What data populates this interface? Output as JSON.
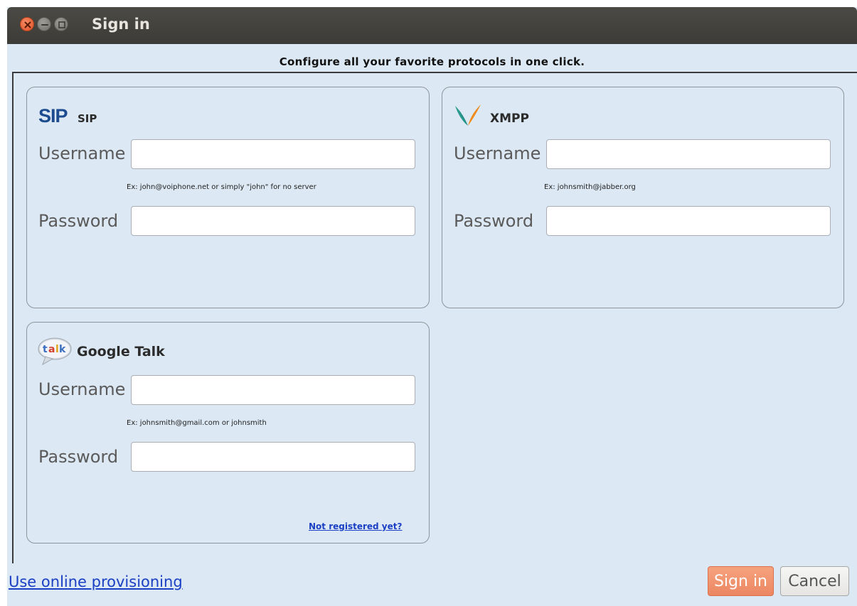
{
  "window": {
    "title": "Sign in",
    "header": "Configure all your favorite protocols in one click."
  },
  "panels": {
    "sip": {
      "logo_text": "SIP",
      "title": "SIP",
      "username_label": "Username",
      "username_value": "",
      "hint": "Ex: john@voiphone.net or simply \"john\" for no server",
      "password_label": "Password",
      "password_value": ""
    },
    "xmpp": {
      "title": "XMPP",
      "username_label": "Username",
      "username_value": "",
      "hint": "Ex: johnsmith@jabber.org",
      "password_label": "Password",
      "password_value": ""
    },
    "gtalk": {
      "logo_text": "talk",
      "title": "Google Talk",
      "username_label": "Username",
      "username_value": "",
      "hint": "Ex: johnsmith@gmail.com or johnsmith",
      "password_label": "Password",
      "password_value": "",
      "register_link": "Not registered yet?"
    }
  },
  "footer": {
    "provisioning_link": "Use online provisioning",
    "sign_in_label": "Sign in",
    "cancel_label": "Cancel"
  },
  "icons": {
    "close": "close-icon",
    "minimize": "minimize-icon",
    "maximize": "maximize-icon",
    "sip_logo": "sip-logo-icon",
    "xmpp_logo": "xmpp-logo-icon",
    "gtalk_logo": "google-talk-icon"
  },
  "colors": {
    "background": "#dce8f3",
    "titlebar": "#3c3b37",
    "link": "#1a3fc4",
    "primary_button": "#ec8762",
    "sip_logo": "#1c4b8f"
  }
}
